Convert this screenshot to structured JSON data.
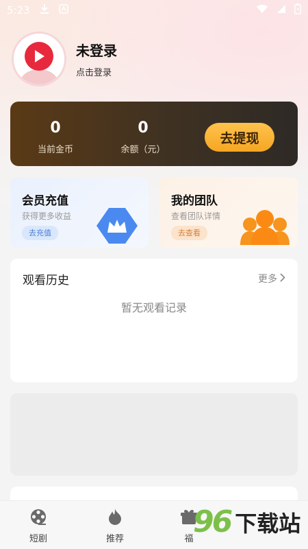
{
  "status_bar": {
    "time": "5:23"
  },
  "profile": {
    "name": "未登录",
    "subtitle": "点击登录"
  },
  "wallet": {
    "coins_value": "0",
    "coins_label": "当前金币",
    "balance_value": "0",
    "balance_label": "余额（元）",
    "withdraw_label": "去提现"
  },
  "features": {
    "vip": {
      "title": "会员充值",
      "subtitle": "获得更多收益",
      "button": "去充值"
    },
    "team": {
      "title": "我的团队",
      "subtitle": "查看团队详情",
      "button": "去查看"
    }
  },
  "history": {
    "title": "观看历史",
    "more": "更多",
    "empty": "暂无观看记录"
  },
  "nav": {
    "items": [
      {
        "label": "短剧",
        "icon": "film-reel-icon"
      },
      {
        "label": "推荐",
        "icon": "flame-icon"
      },
      {
        "label": "福",
        "icon": "gift-icon"
      }
    ]
  },
  "watermark": {
    "digits": "96",
    "text": "下载站"
  },
  "colors": {
    "accent_gold": "#f5a623",
    "wallet_bg": "#3f3122",
    "vip_blue": "#4a8af0",
    "team_orange": "#f7941d",
    "avatar_red": "#e8283c"
  }
}
